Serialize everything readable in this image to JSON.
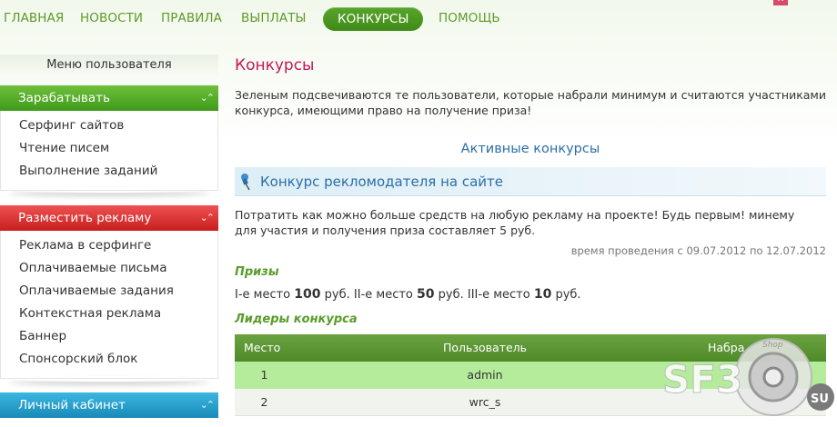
{
  "nav": {
    "items": [
      "ГЛАВНАЯ",
      "НОВОСТИ",
      "ПРАВИЛА",
      "ВЫПЛАТЫ",
      "КОНКУРСЫ",
      "ПОМОЩЬ"
    ],
    "active": "КОНКУРСЫ"
  },
  "sidebar": {
    "menu_title": "Меню пользователя",
    "earn": {
      "title": "Зарабатывать",
      "links": [
        "Серфинг сайтов",
        "Чтение писем",
        "Выполнение заданий"
      ]
    },
    "advertise": {
      "title": "Разместить рекламу",
      "links": [
        "Реклама в серфинге",
        "Оплачиваемые письма",
        "Оплачиваемые задания",
        "Контекстная реклама",
        "Баннер",
        "Спонсорский блок"
      ]
    },
    "cabinet": {
      "title": "Личный кабинет"
    }
  },
  "main": {
    "title": "Конкурсы",
    "intro": "Зеленым подсвечиваются те пользователи, которые набрали минимум и считаются участниками конкурса, имеющими право на получение приза!",
    "active_title": "Активные конкурсы",
    "contest": {
      "name": "Конкурс рекломодателя на сайте",
      "description": "Потратить как можно больше средств на любую рекламу на проекте! Будь первым! минему для участия и получения приза составляет 5 руб.",
      "dates": "время проведения с 09.07.2012 по 12.07.2012",
      "prizes_label": "Призы",
      "prizes": {
        "p1_label": "I-е место",
        "p1_amount": "100",
        "p1_unit": "руб.",
        "p2_label": "II-е место",
        "p2_amount": "50",
        "p2_unit": "руб.",
        "p3_label": "III-е место",
        "p3_amount": "10",
        "p3_unit": "руб."
      },
      "leaders_label": "Лидеры конкурса",
      "table": {
        "headers": [
          "Место",
          "Пользователь",
          "Набра"
        ],
        "rows": [
          {
            "place": "1",
            "user": "admin"
          },
          {
            "place": "2",
            "user": "wrc_s"
          }
        ]
      }
    }
  },
  "watermark": {
    "text": "SF3",
    "suffix": "SU",
    "small": "Shop"
  },
  "colors": {
    "green": "#5e9a2a",
    "title_red": "#c2185b",
    "link_blue": "#2a6fa8"
  }
}
